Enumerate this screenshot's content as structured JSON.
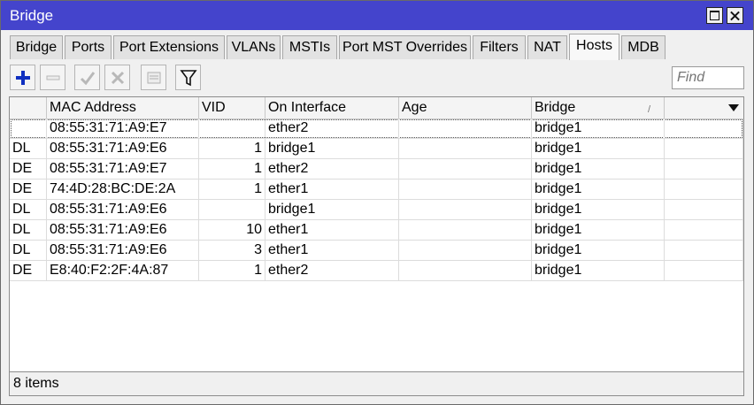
{
  "window": {
    "title": "Bridge"
  },
  "tabs": [
    "Bridge",
    "Ports",
    "Port Extensions",
    "VLANs",
    "MSTIs",
    "Port MST Overrides",
    "Filters",
    "NAT",
    "Hosts",
    "MDB"
  ],
  "active_tab": "Hosts",
  "toolbar": {
    "buttons": [
      "add-icon",
      "remove-icon",
      "enable-icon",
      "disable-icon",
      "comment-icon",
      "filter-icon"
    ],
    "find_placeholder": "Find",
    "accent": "#1030c0"
  },
  "table": {
    "columns": [
      "",
      "MAC Address",
      "VID",
      "On Interface",
      "Age",
      "Bridge",
      ""
    ],
    "sort_indicator": "/",
    "rows": [
      {
        "flags": "",
        "mac": "08:55:31:71:A9:E7",
        "vid": "",
        "iface": "ether2",
        "age": "",
        "bridge": "bridge1"
      },
      {
        "flags": "DL",
        "mac": "08:55:31:71:A9:E6",
        "vid": "1",
        "iface": "bridge1",
        "age": "",
        "bridge": "bridge1"
      },
      {
        "flags": "DE",
        "mac": "08:55:31:71:A9:E7",
        "vid": "1",
        "iface": "ether2",
        "age": "",
        "bridge": "bridge1"
      },
      {
        "flags": "DE",
        "mac": "74:4D:28:BC:DE:2A",
        "vid": "1",
        "iface": "ether1",
        "age": "",
        "bridge": "bridge1"
      },
      {
        "flags": "DL",
        "mac": "08:55:31:71:A9:E6",
        "vid": "",
        "iface": "bridge1",
        "age": "",
        "bridge": "bridge1"
      },
      {
        "flags": "DL",
        "mac": "08:55:31:71:A9:E6",
        "vid": "10",
        "iface": "ether1",
        "age": "",
        "bridge": "bridge1"
      },
      {
        "flags": "DL",
        "mac": "08:55:31:71:A9:E6",
        "vid": "3",
        "iface": "ether1",
        "age": "",
        "bridge": "bridge1"
      },
      {
        "flags": "DE",
        "mac": "E8:40:F2:2F:4A:87",
        "vid": "1",
        "iface": "ether2",
        "age": "",
        "bridge": "bridge1"
      }
    ]
  },
  "status": {
    "text": "8 items"
  },
  "colors": {
    "titlebar": "#4444cc",
    "window_bg": "#f0f0f0"
  }
}
